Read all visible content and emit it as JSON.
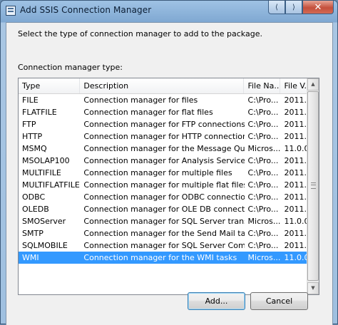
{
  "window": {
    "title": "Add SSIS Connection Manager"
  },
  "titlebar_buttons": {
    "back": "⟨",
    "forward": "⟩",
    "close": "✕"
  },
  "instructions": "Select the type of connection manager to add to the package.",
  "list_label": "Connection manager type:",
  "columns": [
    "Type",
    "Description",
    "File Na...",
    "File V..."
  ],
  "rows": [
    [
      "FILE",
      "Connection manager for files",
      "C:\\Pro...",
      "2011..."
    ],
    [
      "FLATFILE",
      "Connection manager for flat files",
      "C:\\Pro...",
      "2011..."
    ],
    [
      "FTP",
      "Connection manager for FTP connections",
      "C:\\Pro...",
      "2011..."
    ],
    [
      "HTTP",
      "Connection manager for HTTP connections",
      "C:\\Pro...",
      "2011..."
    ],
    [
      "MSMQ",
      "Connection manager for the Message Queue t...",
      "Micros...",
      "11.0.0..."
    ],
    [
      "MSOLAP100",
      "Connection manager for Analysis Services con...",
      "C:\\Pro...",
      "2011..."
    ],
    [
      "MULTIFILE",
      "Connection manager for multiple files",
      "C:\\Pro...",
      "2011..."
    ],
    [
      "MULTIFLATFILE",
      "Connection manager for multiple flat files",
      "C:\\Pro...",
      "2011..."
    ],
    [
      "ODBC",
      "Connection manager for ODBC connections",
      "C:\\Pro...",
      "2011..."
    ],
    [
      "OLEDB",
      "Connection manager for OLE DB connections",
      "C:\\Pro...",
      "2011..."
    ],
    [
      "SMOServer",
      "Connection manager for SQL Server transfer ta...",
      "Micros...",
      "11.0.0..."
    ],
    [
      "SMTP",
      "Connection manager for the Send Mail task",
      "C:\\Pro...",
      "2011..."
    ],
    [
      "SQLMOBILE",
      "Connection manager for SQL Server Compact ...",
      "C:\\Pro...",
      "2011..."
    ],
    [
      "WMI",
      "Connection manager for the WMI tasks",
      "Micros...",
      "11.0.0..."
    ]
  ],
  "selected_row": 13,
  "buttons": {
    "add": "Add...",
    "cancel": "Cancel"
  },
  "colors": {
    "selection": "#3399ff",
    "dialog_bg": "#f0f0f0"
  }
}
